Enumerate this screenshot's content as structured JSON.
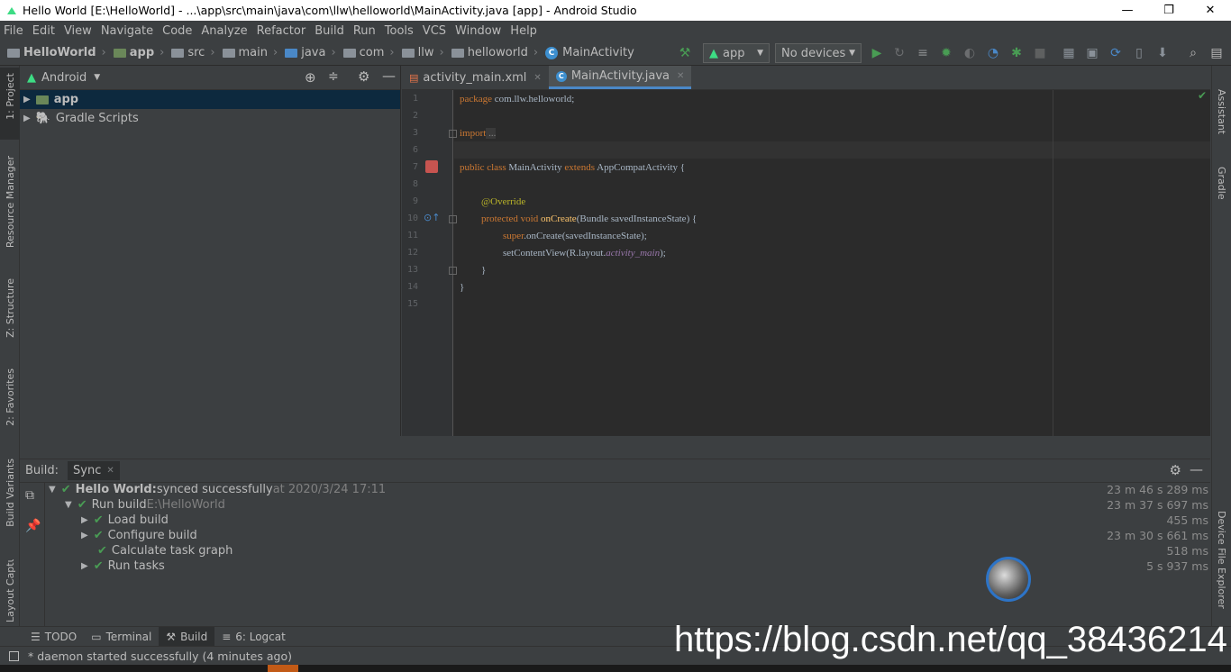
{
  "window": {
    "title": "Hello World [E:\\HelloWorld] - ...\\app\\src\\main\\java\\com\\llw\\helloworld\\MainActivity.java [app] - Android Studio",
    "min": "—",
    "max": "❐",
    "close": "✕"
  },
  "menu": [
    "File",
    "Edit",
    "View",
    "Navigate",
    "Code",
    "Analyze",
    "Refactor",
    "Build",
    "Run",
    "Tools",
    "VCS",
    "Window",
    "Help"
  ],
  "breadcrumb": {
    "project": "HelloWorld",
    "items": [
      "app",
      "src",
      "main",
      "java",
      "com",
      "llw",
      "helloworld"
    ],
    "file": "MainActivity",
    "class_icon": "C"
  },
  "toolbar": {
    "run_config": "app",
    "device": "No devices"
  },
  "side_tabs": {
    "left": [
      "1: Project",
      "Resource Manager",
      "Z: Structure",
      "2: Favorites",
      "Build Variants",
      "Layout Captures"
    ],
    "right": [
      "Assistant",
      "Gradle",
      "Device File Explorer"
    ]
  },
  "project": {
    "view": "Android",
    "tree": [
      "app",
      "Gradle Scripts"
    ]
  },
  "editor": {
    "tabs": [
      {
        "label": "activity_main.xml"
      },
      {
        "label": "MainActivity.java"
      }
    ],
    "line_numbers": [
      "1",
      "2",
      "3",
      "6",
      "7",
      "8",
      "9",
      "10",
      "11",
      "12",
      "13",
      "14",
      "15"
    ],
    "code": {
      "l1a": "package",
      "l1b": " com.llw.helloworld;",
      "l3a": "import",
      "l3b": " ...",
      "l7a": "public class",
      "l7b": " MainActivity ",
      "l7c": "extends",
      "l7d": " AppCompatActivity {",
      "l9": "@Override",
      "l10a": "protected void",
      "l10b": " onCreate",
      "l10c": "(Bundle savedInstanceState) {",
      "l11a": "super",
      "l11b": ".onCreate(savedInstanceState);",
      "l12a": "setContentView(R.layout.",
      "l12b": "activity_main",
      "l12c": ");",
      "l13": "}",
      "l14": "}"
    }
  },
  "build": {
    "label": "Build:",
    "tab": "Sync",
    "rows": [
      {
        "bold": "Hello World:",
        "text": " synced successfully",
        "extra": " at 2020/3/24 17:11",
        "time": "23 m 46 s 289 ms"
      },
      {
        "text": "Run build",
        "extra": " E:\\HelloWorld",
        "time": "23 m 37 s 697 ms"
      },
      {
        "text": "Load build",
        "time": "455 ms"
      },
      {
        "text": "Configure build",
        "time": "23 m 30 s 661 ms"
      },
      {
        "text": "Calculate task graph",
        "time": "518 ms"
      },
      {
        "text": "Run tasks",
        "time": "5 s 937 ms"
      }
    ]
  },
  "bottom_tabs": [
    "TODO",
    "Terminal",
    "Build",
    "6: Logcat"
  ],
  "status": "* daemon started successfully (4 minutes ago)",
  "watermark": "https://blog.csdn.net/qq_38436214",
  "colors": {
    "accent": "#4a88c7",
    "success": "#499c54",
    "run": "#499c54"
  }
}
